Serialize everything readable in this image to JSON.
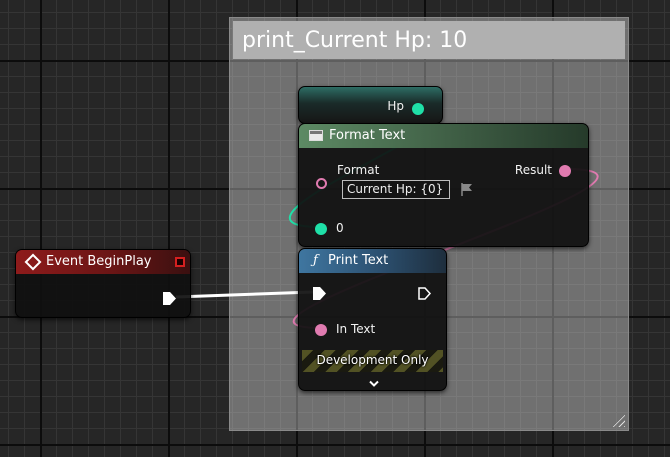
{
  "comment": {
    "title": "print_Current Hp: 10"
  },
  "nodes": {
    "get_hp": {
      "pin_label": "Hp"
    },
    "format_text": {
      "title": "Format Text",
      "format_label": "Format",
      "format_value": "Current Hp: {0}",
      "arg_label": "0",
      "result_label": "Result"
    },
    "print_text": {
      "icon": "ƒ",
      "title": "Print Text",
      "in_text_label": "In Text",
      "dev_only": "Development Only",
      "expand_icon": "⌄"
    },
    "event_begin_play": {
      "icon": "◆",
      "title": "Event BeginPlay"
    }
  },
  "colors": {
    "text_pin": "#e07bb0",
    "int_pin": "#1fe0a8",
    "event_header": "#8a1a1a",
    "function_header": "#3c6f96",
    "pure_header": "#557a5c",
    "exec": "#ffffff"
  }
}
